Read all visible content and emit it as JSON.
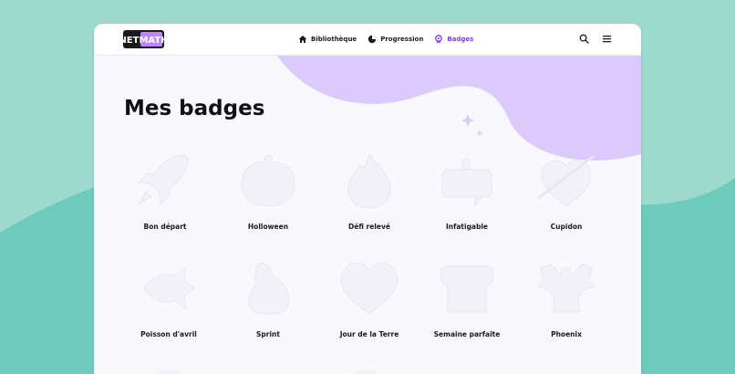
{
  "header": {
    "logo_text": "NETMATH",
    "nav": [
      {
        "label": "Bibliothèque",
        "icon": "home-icon",
        "active": false
      },
      {
        "label": "Progression",
        "icon": "pie-chart-icon",
        "active": false
      },
      {
        "label": "Badges",
        "icon": "badge-icon",
        "active": true
      }
    ],
    "icons": [
      "search-icon",
      "menu-icon"
    ]
  },
  "page": {
    "title": "Mes badges"
  },
  "badges": [
    {
      "label": "Bon départ",
      "icon": "rocket-icon"
    },
    {
      "label": "Holloween",
      "icon": "pumpkin-icon"
    },
    {
      "label": "Défi relevé",
      "icon": "flame-icon"
    },
    {
      "label": "Infatigable",
      "icon": "thumbs-up-icon"
    },
    {
      "label": "Cupidon",
      "icon": "heart-arrow-icon"
    },
    {
      "label": "Poisson d'avril",
      "icon": "fish-icon"
    },
    {
      "label": "Sprint",
      "icon": "running-shoe-icon"
    },
    {
      "label": "Jour de la Terre",
      "icon": "heart-icon"
    },
    {
      "label": "Semaine parfaite",
      "icon": "bread-icon"
    },
    {
      "label": "Phoenix",
      "icon": "phoenix-icon"
    }
  ],
  "colors": {
    "accent": "#7c3aed",
    "blob": "#dccafd",
    "background": "#9dd9cd",
    "wave": "#6ccbbd",
    "badge_fill": "#f2f1f8"
  }
}
